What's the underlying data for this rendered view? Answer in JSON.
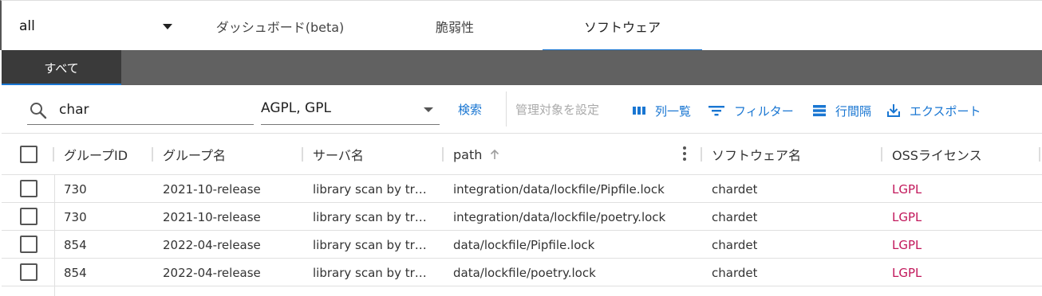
{
  "header": {
    "group_select": {
      "value": "all"
    },
    "tabs": [
      {
        "label": "ダッシュボード(beta)"
      },
      {
        "label": "脆弱性"
      },
      {
        "label": "ソフトウェア"
      }
    ],
    "active_tab": "ソフトウェア"
  },
  "subtabs": [
    {
      "label": "すべて"
    }
  ],
  "toolbar": {
    "search_value": "char",
    "license_filter": "AGPL, GPL",
    "search_label": "検索",
    "manage_label": "管理対象を設定",
    "columns_label": "列一覧",
    "filter_label": "フィルター",
    "density_label": "行間隔",
    "export_label": "エクスポート"
  },
  "table": {
    "columns": [
      "グループID",
      "グループ名",
      "サーバ名",
      "path",
      "ソフトウェア名",
      "OSSライセンス"
    ],
    "sort": {
      "column": "path",
      "direction": "asc"
    },
    "rows": [
      {
        "group_id": "730",
        "group_name": "2021-10-release",
        "server": "library scan by tr…",
        "path": "integration/data/lockfile/Pipfile.lock",
        "software": "chardet",
        "license": "LGPL"
      },
      {
        "group_id": "730",
        "group_name": "2021-10-release",
        "server": "library scan by tr…",
        "path": "integration/data/lockfile/poetry.lock",
        "software": "chardet",
        "license": "LGPL"
      },
      {
        "group_id": "854",
        "group_name": "2022-04-release",
        "server": "library scan by tr…",
        "path": "data/lockfile/Pipfile.lock",
        "software": "chardet",
        "license": "LGPL"
      },
      {
        "group_id": "854",
        "group_name": "2022-04-release",
        "server": "library scan by tr…",
        "path": "data/lockfile/poetry.lock",
        "software": "chardet",
        "license": "LGPL"
      }
    ]
  },
  "colors": {
    "accent": "#1976d2",
    "license": "#c2185b",
    "subbar": "#616161"
  },
  "icons": [
    "chevron-down-icon",
    "search-icon",
    "columns-icon",
    "filter-icon",
    "density-icon",
    "export-icon",
    "sort-arrow-up-icon",
    "more-vert-icon"
  ]
}
